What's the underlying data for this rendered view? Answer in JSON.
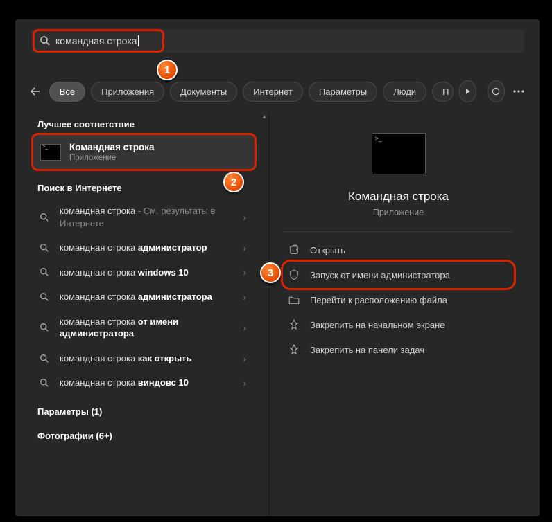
{
  "search": {
    "value": "командная строка"
  },
  "tabs": {
    "all": "Все",
    "apps": "Приложения",
    "docs": "Документы",
    "web": "Интернет",
    "settings": "Параметры",
    "people": "Люди",
    "cut": "П"
  },
  "left": {
    "bestMatch": "Лучшее соответствие",
    "topResult": {
      "title": "Командная строка",
      "sub": "Приложение"
    },
    "webHeader": "Поиск в Интернете",
    "suggestions": [
      {
        "main": "командная строка",
        "rest": " - См. результаты в Интернете"
      },
      {
        "main": "командная строка ",
        "bold": "администратор"
      },
      {
        "main": "командная строка ",
        "bold": "windows 10"
      },
      {
        "main": "командная строка ",
        "bold": "администратора"
      },
      {
        "main": "командная строка ",
        "bold": "от имени администратора"
      },
      {
        "main": "командная строка ",
        "bold": "как открыть"
      },
      {
        "main": "командная строка ",
        "bold": "виндовс 10"
      }
    ],
    "paramsHeader": "Параметры (1)",
    "photosHeader": "Фотографии (6+)"
  },
  "right": {
    "title": "Командная строка",
    "sub": "Приложение",
    "actions": {
      "open": "Открыть",
      "admin": "Запуск от имени администратора",
      "location": "Перейти к расположению файла",
      "pinStart": "Закрепить на начальном экране",
      "pinTaskbar": "Закрепить на панели задач"
    }
  },
  "badges": {
    "b1": "1",
    "b2": "2",
    "b3": "3"
  }
}
